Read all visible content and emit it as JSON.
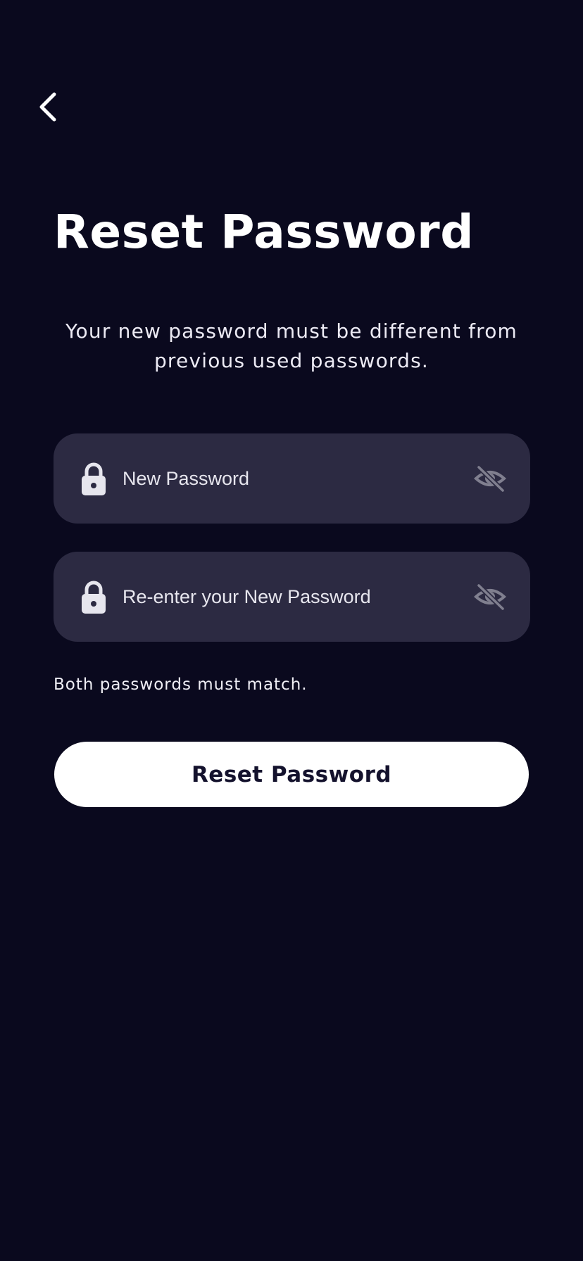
{
  "nav": {
    "back_icon": "chevron-left-icon"
  },
  "header": {
    "title": "Reset Password",
    "subtitle": "Your new password must be different from previous used passwords."
  },
  "form": {
    "new_password": {
      "value": "",
      "placeholder": "New Password",
      "leading_icon": "lock-icon",
      "trailing_icon": "eye-off-icon"
    },
    "confirm_password": {
      "value": "",
      "placeholder": "Re-enter your New Password",
      "leading_icon": "lock-icon",
      "trailing_icon": "eye-off-icon"
    },
    "hint": "Both passwords must match.",
    "submit_label": "Reset Password"
  },
  "colors": {
    "background": "#0a091e",
    "field_background": "#2c2a42",
    "button_background": "#ffffff",
    "button_text": "#14122d",
    "icon_muted": "#807f8f"
  }
}
